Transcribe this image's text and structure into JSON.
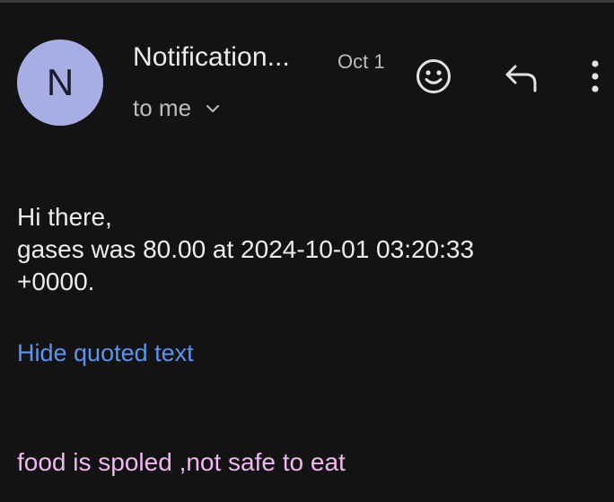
{
  "header": {
    "avatar_letter": "N",
    "sender": "Notification...",
    "date": "Oct 1",
    "recipient": "to me",
    "icons": {
      "emoji": "smiley-face-icon",
      "reply": "reply-arrow-icon",
      "more": "vertical-dots-icon",
      "recipient_expand": "chevron-down-icon"
    }
  },
  "message": {
    "greeting": "Hi there,",
    "line1": "gases was 80.00 at 2024-10-01 03:20:33",
    "line2": "+0000."
  },
  "quoted": {
    "toggle_label": "Hide quoted text",
    "text": "food is spoled ,not safe to eat"
  },
  "colors": {
    "background": "#131313",
    "avatar": "#a7aee3",
    "link": "#5b95f0",
    "quoted_text": "#f1b7f1"
  }
}
